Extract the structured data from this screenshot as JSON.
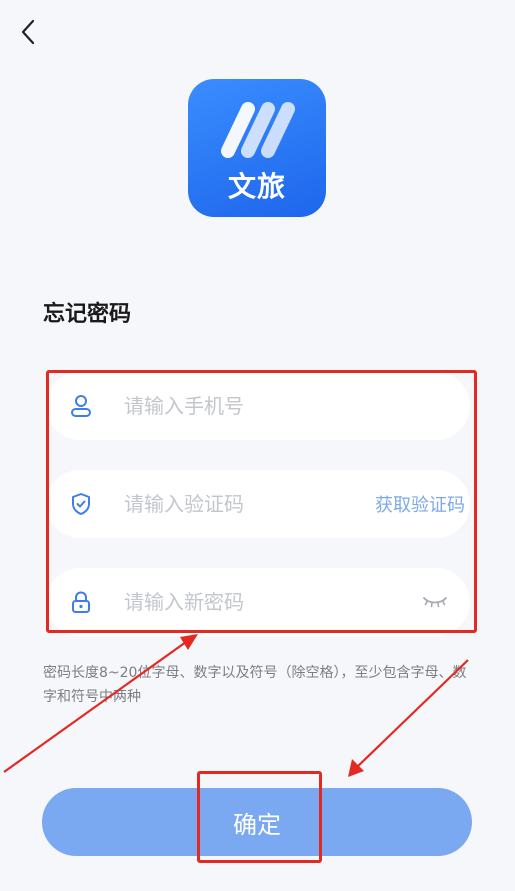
{
  "app": {
    "logo_text": "文旅"
  },
  "page": {
    "title": "忘记密码"
  },
  "form": {
    "phone_placeholder": "请输入手机号",
    "code_placeholder": "请输入验证码",
    "get_code_label": "获取验证码",
    "password_placeholder": "请输入新密码",
    "hint": "密码长度8~20位字母、数字以及符号（除空格），至少包含字母、数字和符号中两种"
  },
  "actions": {
    "confirm_label": "确定"
  },
  "icons": {
    "back": "chevron-left-icon",
    "phone": "user-icon",
    "code": "shield-check-icon",
    "password": "lock-icon",
    "visibility": "eye-closed-icon"
  },
  "colors": {
    "brand": "#1d66ec",
    "button": "#7aa8f1",
    "link": "#7fa8ea",
    "annotation": "#e32a22"
  }
}
